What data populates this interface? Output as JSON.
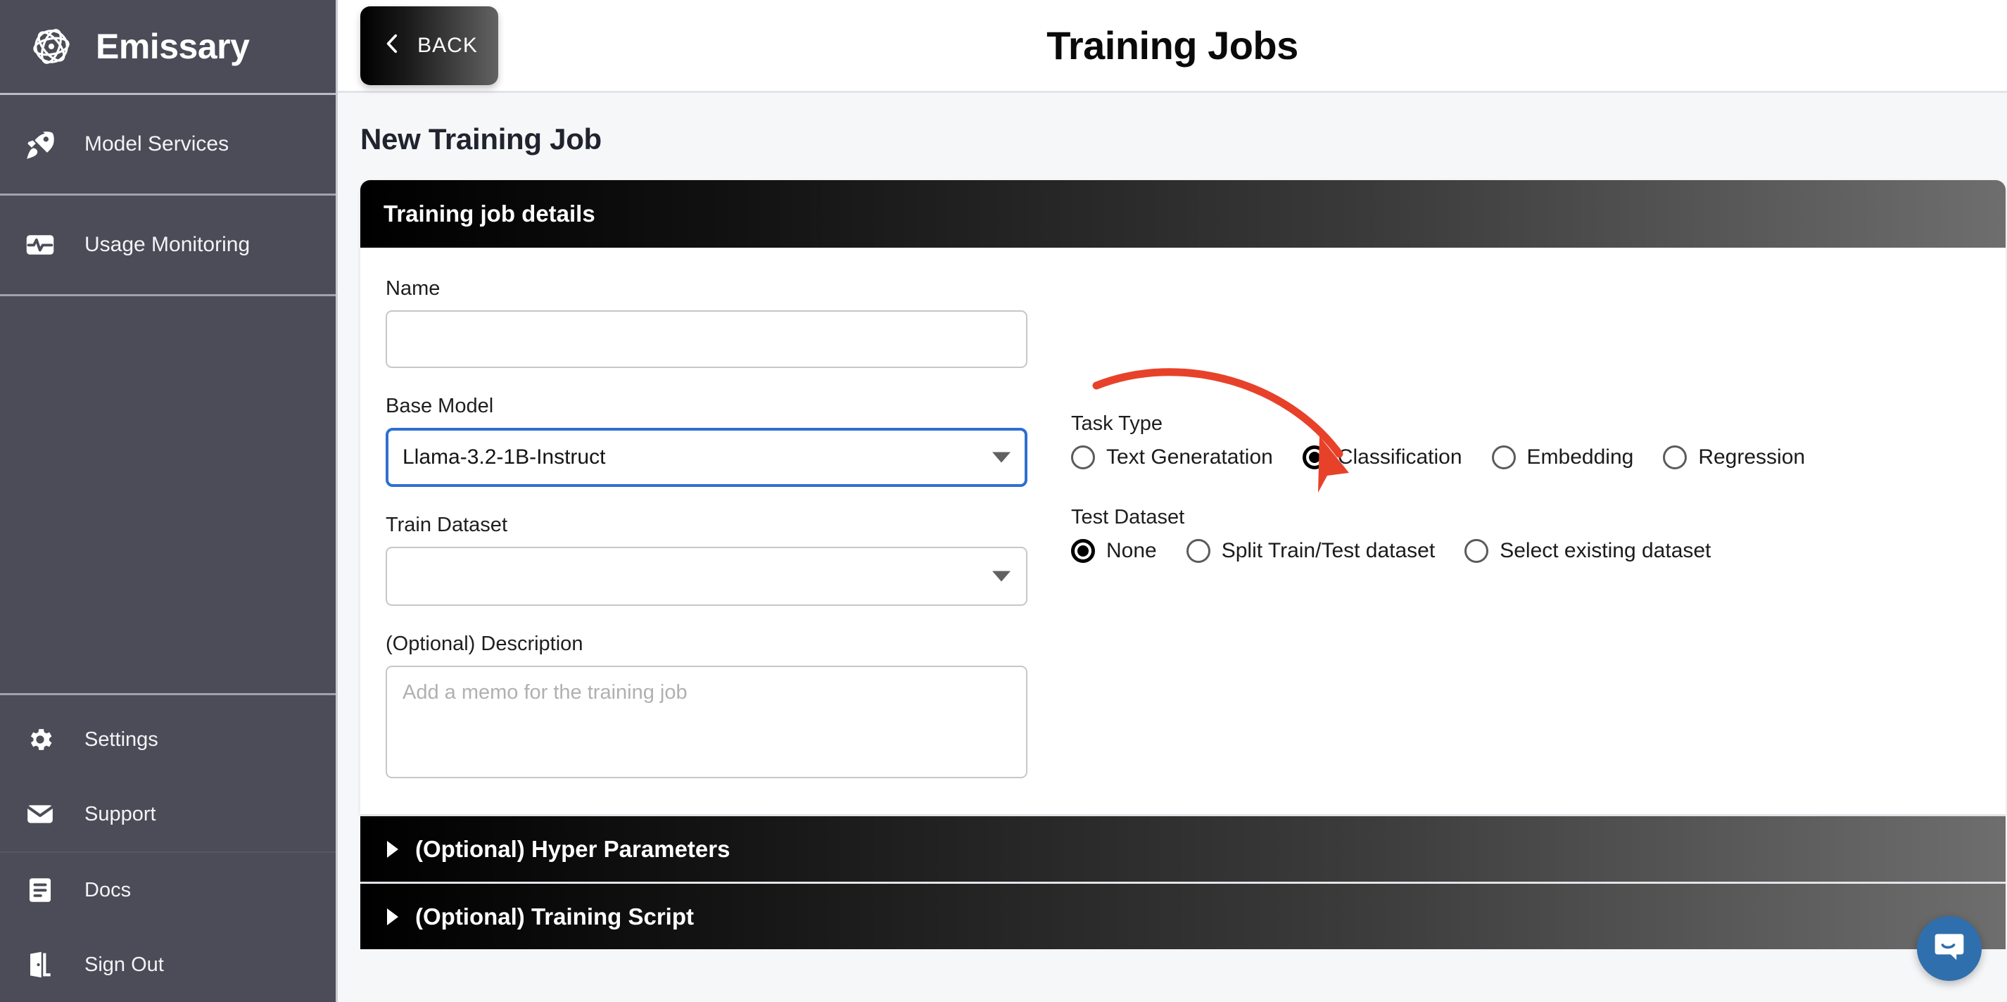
{
  "sidebar": {
    "brand": {
      "name": "Emissary",
      "logo_icon": "atom-logo-icon"
    },
    "primary_items": [
      {
        "label": "Model Services",
        "icon": "rocket-icon"
      },
      {
        "label": "Usage Monitoring",
        "icon": "monitor-pulse-icon"
      }
    ],
    "bottom_items": [
      {
        "label": "Settings",
        "icon": "gear-icon"
      },
      {
        "label": "Support",
        "icon": "envelope-icon"
      },
      {
        "label": "Docs",
        "icon": "document-icon"
      },
      {
        "label": "Sign Out",
        "icon": "exit-door-icon"
      }
    ]
  },
  "topbar": {
    "back_label": "BACK",
    "back_icon": "chevron-left-icon",
    "title": "Training Jobs"
  },
  "page": {
    "heading": "New Training Job"
  },
  "card": {
    "header_title": "Training job details",
    "name": {
      "label": "Name",
      "value": "",
      "placeholder": ""
    },
    "base_model": {
      "label": "Base Model",
      "value": "Llama-3.2-1B-Instruct",
      "focused": true,
      "caret_icon": "chevron-down-icon"
    },
    "train_dataset": {
      "label": "Train Dataset",
      "value": "",
      "caret_icon": "chevron-down-icon"
    },
    "description": {
      "label": "(Optional) Description",
      "value": "",
      "placeholder": "Add a memo for the training job"
    },
    "task_type": {
      "label": "Task Type",
      "selected": "Classification",
      "options": [
        {
          "label": "Text Generatation",
          "checked": false
        },
        {
          "label": "Classification",
          "checked": true
        },
        {
          "label": "Embedding",
          "checked": false
        },
        {
          "label": "Regression",
          "checked": false
        }
      ]
    },
    "test_dataset": {
      "label": "Test Dataset",
      "selected": "None",
      "options": [
        {
          "label": "None",
          "checked": true
        },
        {
          "label": "Split Train/Test dataset",
          "checked": false
        },
        {
          "label": "Select existing dataset",
          "checked": false
        }
      ]
    }
  },
  "accordions": [
    {
      "title": "(Optional) Hyper Parameters",
      "expanded": false,
      "caret_icon": "caret-right-icon"
    },
    {
      "title": "(Optional) Training Script",
      "expanded": false,
      "caret_icon": "caret-right-icon"
    }
  ],
  "annotation": {
    "arrow_color": "#E8412A",
    "points_at": "Classification"
  },
  "chat": {
    "icon": "chat-bubble-icon",
    "color": "#2F6FAD"
  },
  "colors": {
    "sidebar_bg": "#4B4C58",
    "accent_blue": "#2F6FD0",
    "page_bg": "#F6F7F9",
    "card_header_start": "#000000",
    "card_header_end": "#6E6E6E"
  }
}
